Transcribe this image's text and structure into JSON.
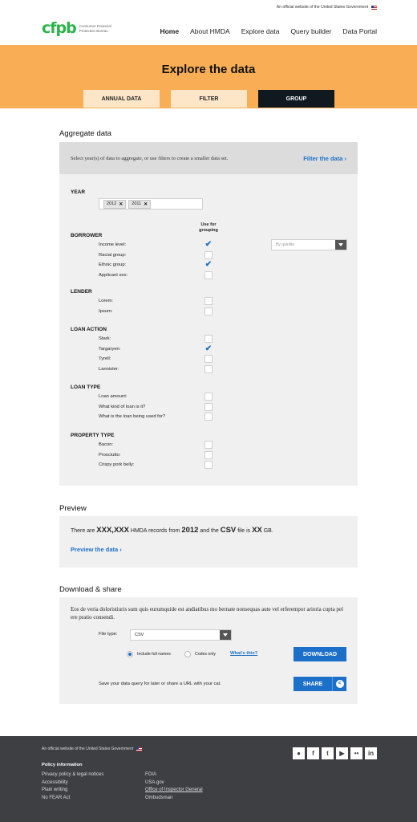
{
  "gov_banner": "An official website of the United States Government",
  "logo": {
    "mark": "cfpb",
    "text": "Consumer Financial Protection Bureau"
  },
  "nav": [
    "Home",
    "About HMDA",
    "Explore data",
    "Query builder",
    "Data Portal"
  ],
  "hero": {
    "title": "Explore the data",
    "tabs": [
      "ANNUAL DATA",
      "FILTER",
      "GROUP"
    ]
  },
  "aggregate": {
    "title": "Aggregate data",
    "hint": "Select year(s) of data to aggregate, or use filters to create a smaller data set.",
    "filter_link": "Filter the data",
    "year_label": "YEAR",
    "years": [
      "2012",
      "2011"
    ],
    "use_for": "Use for grouping",
    "quintile_placeholder": "By quintile",
    "groups": [
      {
        "name": "BORROWER",
        "rows": [
          {
            "label": "Income level:",
            "checked": true
          },
          {
            "label": "Racial group:",
            "checked": false
          },
          {
            "label": "Ethnic group:",
            "checked": true
          },
          {
            "label": "Applicant sex:",
            "checked": false
          }
        ]
      },
      {
        "name": "LENDER",
        "rows": [
          {
            "label": "Lorem:",
            "checked": false
          },
          {
            "label": "Ipsum:",
            "checked": false
          }
        ]
      },
      {
        "name": "LOAN ACTION",
        "rows": [
          {
            "label": "Stark:",
            "checked": false
          },
          {
            "label": "Targaryen:",
            "checked": true
          },
          {
            "label": "Tyrell:",
            "checked": false
          },
          {
            "label": "Lannister:",
            "checked": false
          }
        ]
      },
      {
        "name": "LOAN TYPE",
        "rows": [
          {
            "label": "Loan amount:",
            "checked": false
          },
          {
            "label": "What kind of loan is it?",
            "checked": false
          },
          {
            "label": "What is the loan being used for?",
            "checked": false
          }
        ]
      },
      {
        "name": "PROPERTY TYPE",
        "rows": [
          {
            "label": "Bacon:",
            "checked": false
          },
          {
            "label": "Prosciutto:",
            "checked": false
          },
          {
            "label": "Crispy pork belly:",
            "checked": false
          }
        ]
      }
    ]
  },
  "preview": {
    "title": "Preview",
    "t1": "There are ",
    "records": "XXX,XXX",
    "t2": " HMDA records from ",
    "year": "2012",
    "t3": " and the ",
    "format": "CSV",
    "t4": " file is ",
    "size": "XX",
    "t5": " GB.",
    "link": "Preview the data"
  },
  "download": {
    "title": "Download & share",
    "intro": "Eos de veria doloristiuris sum quis eurumquide est andiatibus mo bernate nonsequas aute vel erferempor arioria cupta pel ere pratio consendi.",
    "filetype_label": "File type:",
    "filetype_value": "CSV",
    "radio1": "Include full names",
    "radio2": "Codes only",
    "whats_this": "What's this?",
    "download_btn": "DOWNLOAD",
    "share_text": "Save your data query for later or share a URL with your cat.",
    "share_btn": "SHARE"
  },
  "footer": {
    "gov": "An official website of the United States Government",
    "policy_head": "Policy information",
    "col1": [
      "Privacy policy & legal notices",
      "Accessibility",
      "Plain writing",
      "No FEAR Act"
    ],
    "col2": [
      "FOIA",
      "USA.gov",
      "Office of Inspector General",
      "Ombudsman"
    ],
    "social": [
      "github-icon",
      "facebook-icon",
      "twitter-icon",
      "youtube-icon",
      "flickr-icon",
      "linkedin-icon"
    ]
  }
}
